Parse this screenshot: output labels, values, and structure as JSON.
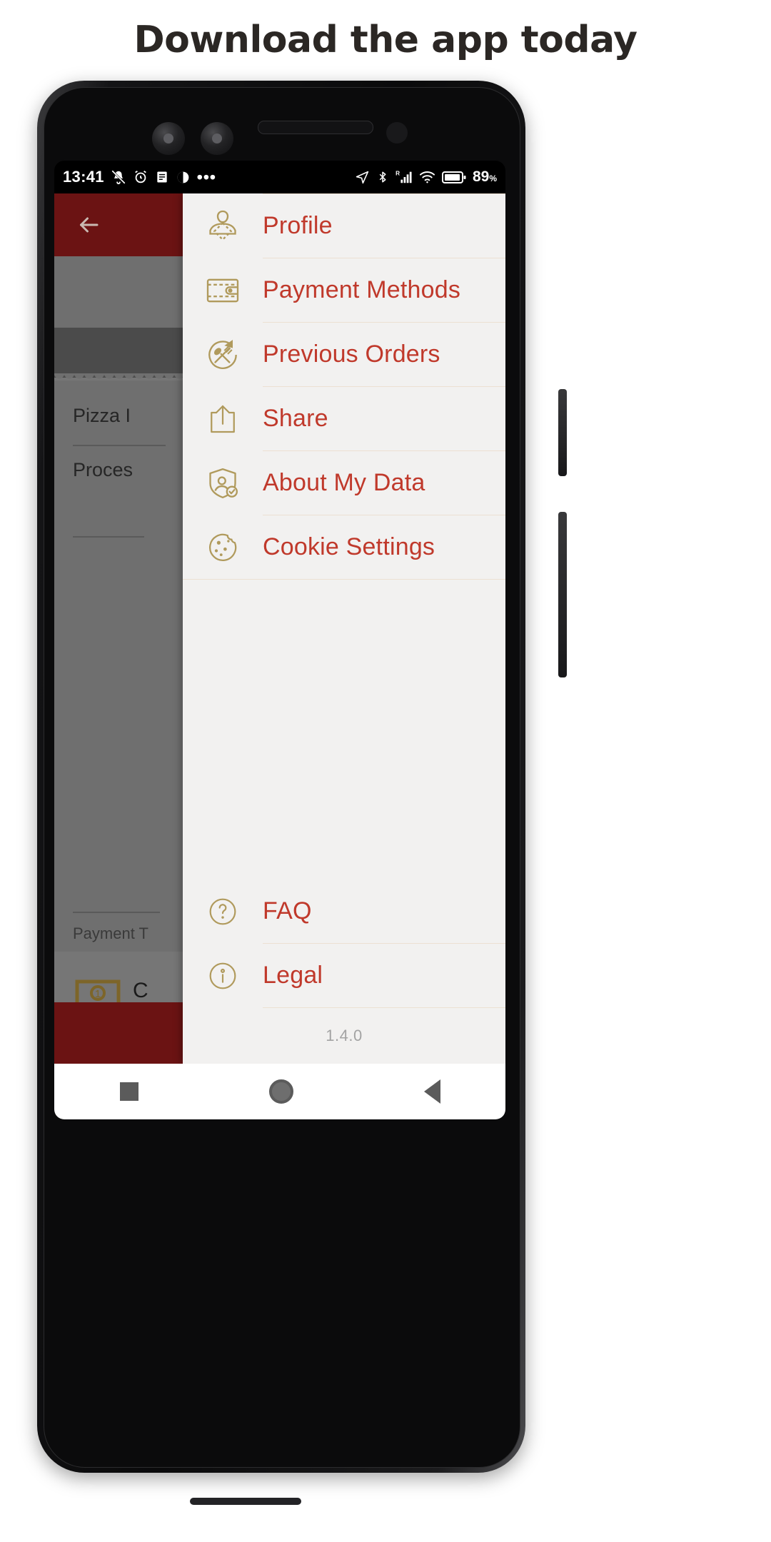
{
  "headline": "Download the app today",
  "statusbar": {
    "time": "13:41",
    "left_icons": [
      "bell-off-icon",
      "alarm-icon",
      "notes-icon",
      "contrast-icon",
      "more-dots-icon"
    ],
    "right_icons": [
      "location-arrow-icon",
      "bluetooth-icon",
      "signal-roaming-icon",
      "wifi-icon",
      "battery-icon"
    ],
    "roaming_label": "R",
    "battery_percent": "89",
    "battery_unit": "%"
  },
  "background_app": {
    "back_icon": "back-arrow-icon",
    "appbar_color": "#6b1313",
    "line1": "Pizza I",
    "line2": "Proces",
    "payment_label": "Payment T",
    "payment_value": "C",
    "payment_icon": "banknote-icon"
  },
  "drawer": {
    "background_color": "#f2f1f0",
    "label_color": "#c0392b",
    "icon_color": "#b09a5c",
    "divider_color": "#ece0d2",
    "items": [
      {
        "label": "Profile",
        "icon": "profile-icon"
      },
      {
        "label": "Payment Methods",
        "icon": "wallet-icon"
      },
      {
        "label": "Previous Orders",
        "icon": "order-history-icon"
      },
      {
        "label": "Share",
        "icon": "share-icon"
      },
      {
        "label": "About My Data",
        "icon": "shield-user-check-icon"
      },
      {
        "label": "Cookie Settings",
        "icon": "cookie-icon"
      }
    ],
    "footer_items": [
      {
        "label": "FAQ",
        "icon": "question-circle-icon"
      },
      {
        "label": "Legal",
        "icon": "info-circle-icon"
      }
    ],
    "version": "1.4.0"
  },
  "navbar": {
    "recents": "recents-square-icon",
    "home": "home-circle-icon",
    "back": "back-triangle-icon"
  }
}
